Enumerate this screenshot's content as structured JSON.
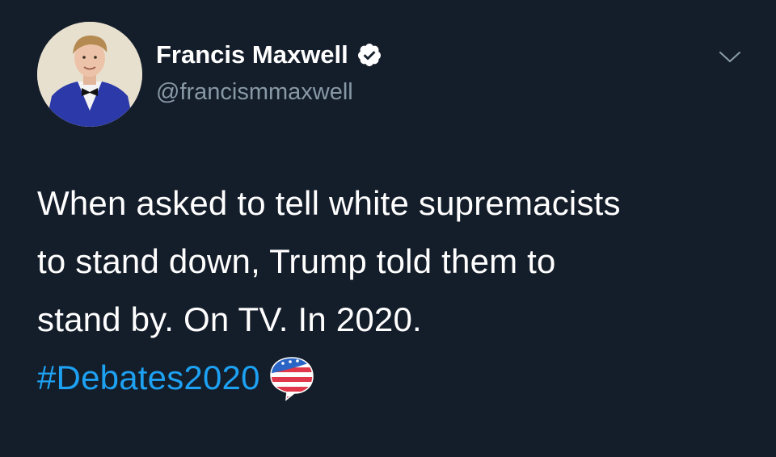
{
  "author": {
    "display_name": "Francis Maxwell",
    "handle": "@francismmaxwell",
    "verified": true
  },
  "tweet": {
    "lines": [
      "When asked to tell white supremacists",
      "to stand down, Trump told them to",
      "stand by. On TV. In 2020."
    ],
    "hashtag": "#Debates2020"
  },
  "icons": {
    "verified": "verified-badge-icon",
    "menu": "chevron-down-icon",
    "hashflag": "us-flag-speech-bubble-icon"
  },
  "colors": {
    "background": "#141d2a",
    "text": "#ffffff",
    "secondary_text": "#8899a6",
    "link": "#1da1f2"
  }
}
